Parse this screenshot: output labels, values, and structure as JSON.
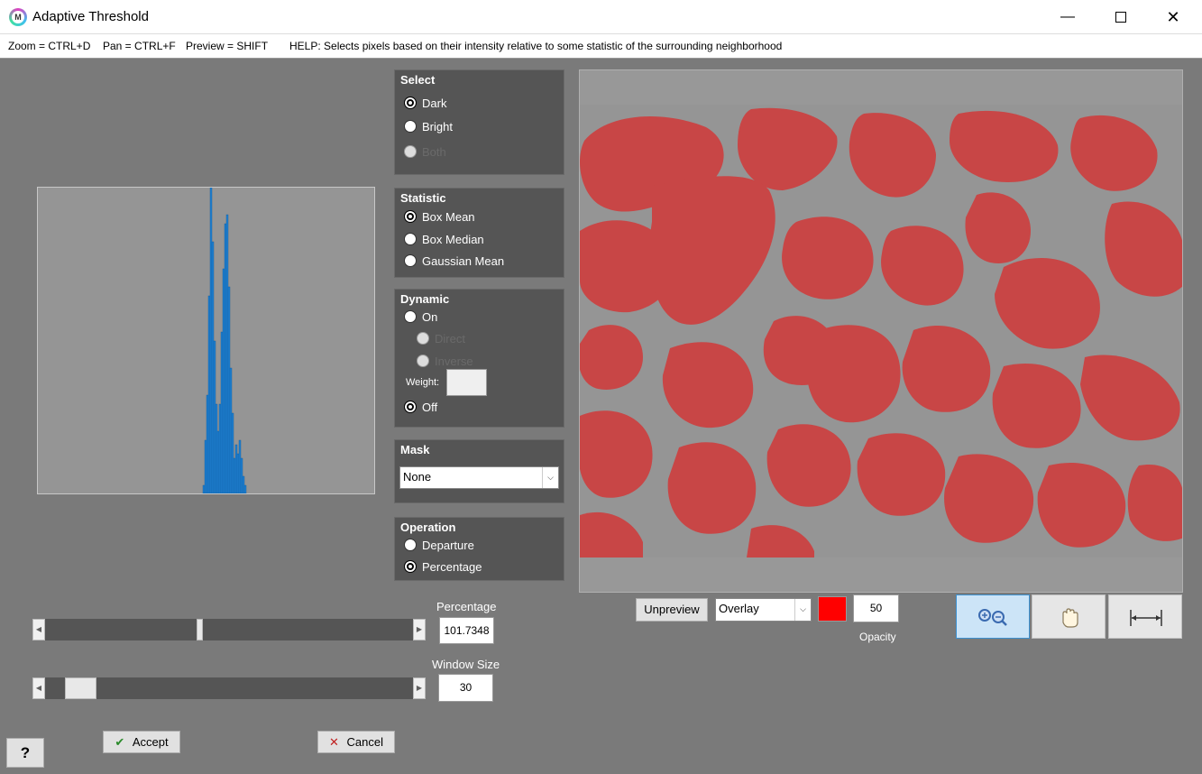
{
  "window": {
    "title": "Adaptive Threshold"
  },
  "help": {
    "zoom": "Zoom = CTRL+D",
    "pan": "Pan = CTRL+F",
    "preview": "Preview = SHIFT",
    "help": "HELP:  Selects pixels based on their intensity relative to some statistic of the surrounding neighborhood"
  },
  "select_panel": {
    "title": "Select",
    "options": [
      {
        "label": "Dark",
        "checked": true,
        "enabled": true
      },
      {
        "label": "Bright",
        "checked": false,
        "enabled": true
      },
      {
        "label": "Both",
        "checked": false,
        "enabled": false
      }
    ]
  },
  "statistic_panel": {
    "title": "Statistic",
    "options": [
      {
        "label": "Box Mean",
        "checked": true
      },
      {
        "label": "Box Median",
        "checked": false
      },
      {
        "label": "Gaussian Mean",
        "checked": false
      }
    ]
  },
  "dynamic_panel": {
    "title": "Dynamic",
    "on_label": "On",
    "direct_label": "Direct",
    "inverse_label": "Inverse",
    "weight_label": "Weight:",
    "weight_value": "",
    "off_label": "Off",
    "selected": "Off"
  },
  "mask_panel": {
    "title": "Mask",
    "selected": "None"
  },
  "operation_panel": {
    "title": "Operation",
    "options": [
      {
        "label": "Departure",
        "checked": false
      },
      {
        "label": "Percentage",
        "checked": true
      }
    ]
  },
  "percentage": {
    "label": "Percentage",
    "value": "101.7348",
    "slider_fraction": 0.42
  },
  "window_size": {
    "label": "Window Size",
    "value": "30",
    "slider_fraction": 0.06
  },
  "preview_controls": {
    "unpreview_label": "Unpreview",
    "display_mode": "Overlay",
    "overlay_color": "#ff0000",
    "opacity_value": "50",
    "opacity_label": "Opacity"
  },
  "tools": {
    "zoom_icon": "zoom-in-out-icon",
    "pan_icon": "hand-pan-icon",
    "fit_icon": "fit-width-icon",
    "active": "zoom"
  },
  "accept_label": "Accept",
  "cancel_label": "Cancel",
  "help_button_label": "?",
  "colors": {
    "background": "#7a7a7a",
    "panel": "#555555",
    "histogram_bars": "#1f7fd0",
    "overlay_red": "#c84646",
    "preview_gray": "#959595"
  }
}
